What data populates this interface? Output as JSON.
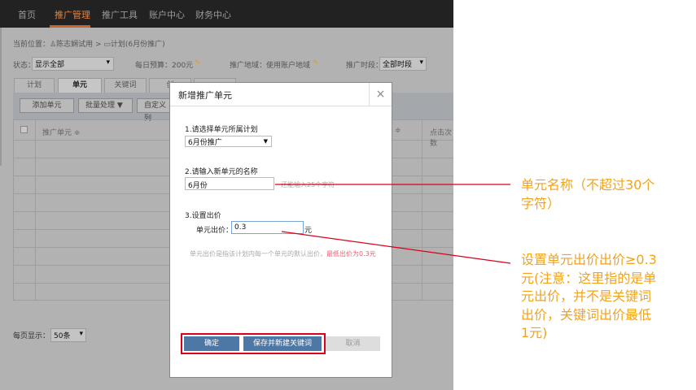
{
  "nav": {
    "items": [
      {
        "label": "首页"
      },
      {
        "label": "推广管理",
        "active": true
      },
      {
        "label": "推广工具"
      },
      {
        "label": "账户中心"
      },
      {
        "label": "财务中心"
      }
    ]
  },
  "breadcrumb": {
    "prefix": "当前位置：",
    "account": "陈志娴试用",
    "sep": ">",
    "plan": "计划(6月份推广)"
  },
  "filters": {
    "status_label": "状态：",
    "status_value": "显示全部",
    "budget": "每日预算：200元",
    "region": "推广地域：使用账户地域",
    "time_label": "推广时段：",
    "time_value": "全部时段"
  },
  "tabs": [
    {
      "label": "计划"
    },
    {
      "label": "单元",
      "active": true
    },
    {
      "label": "关键词"
    },
    {
      "label": "创"
    },
    {
      "label": ""
    }
  ],
  "toolbar": {
    "add": "添加单元",
    "batch": "批量处理 ▼",
    "custom": "自定义列"
  },
  "table": {
    "headers": [
      "推广单元 ≑",
      "≑",
      "点击次数"
    ]
  },
  "pager": {
    "label": "每页显示：",
    "value": "50条"
  },
  "modal": {
    "title": "新增推广单元",
    "close": "×",
    "step1": "1.请选择单元所属计划",
    "plan_value": "6月份推广",
    "step2": "2.请输入新单元的名称",
    "name_value": "6月份",
    "name_hint": "还能输入25个字符",
    "step3": "3.设置出价",
    "bid_label": "单元出价：",
    "bid_value": "0.3",
    "bid_unit": "元",
    "bid_hint": "单元出价是指该计划内每一个单元的默认出价，",
    "bid_hint_red": "最低出价为0.3元",
    "ok": "确定",
    "save_new": "保存并新建关键词",
    "cancel": "取消"
  },
  "annotations": {
    "name": "单元名称（不超过30个字符）",
    "bid": "设置单元出价出价≥0.3元(注意：这里指的是单元出价，并不是关键词出价，关键词出价最低1元)"
  },
  "colors": {
    "accent": "#e8833a",
    "annotation": "#f2a31c",
    "highlight": "#d9001b",
    "button": "#4d77a4"
  }
}
